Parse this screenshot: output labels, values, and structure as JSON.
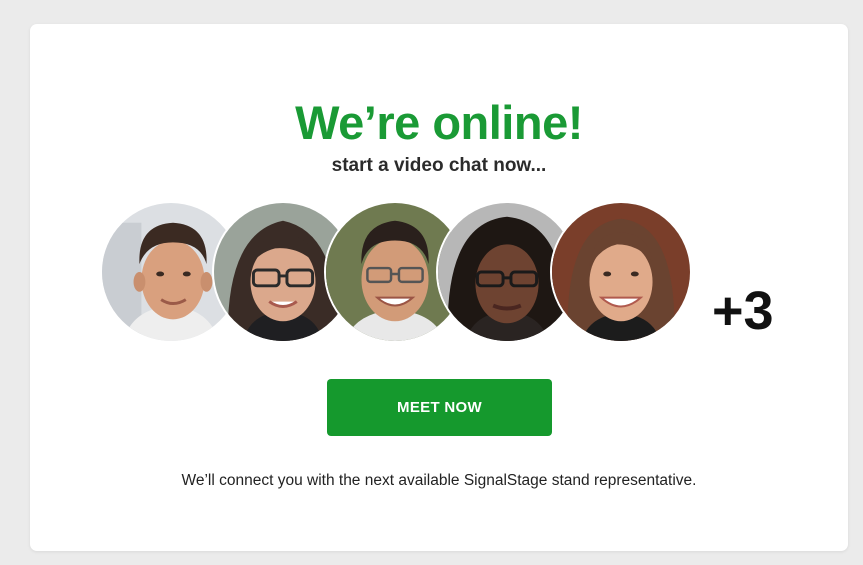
{
  "card": {
    "headline": "We’re online!",
    "subline": "start a video chat now...",
    "more_count": "+3",
    "button_label": "MEET NOW",
    "footnote": "We’ll connect you with the next available SignalStage stand representative."
  },
  "avatars": [
    {
      "icon": "person-photo-man-short-dark-hair"
    },
    {
      "icon": "person-photo-woman-glasses-brown-hair"
    },
    {
      "icon": "person-photo-man-glasses-smiling"
    },
    {
      "icon": "person-photo-woman-glasses-curly-hair"
    },
    {
      "icon": "person-photo-woman-long-brown-hair"
    }
  ],
  "colors": {
    "brand_green": "#1a9a35",
    "button_green": "#15992d",
    "background": "#ebebeb",
    "card": "#ffffff"
  }
}
